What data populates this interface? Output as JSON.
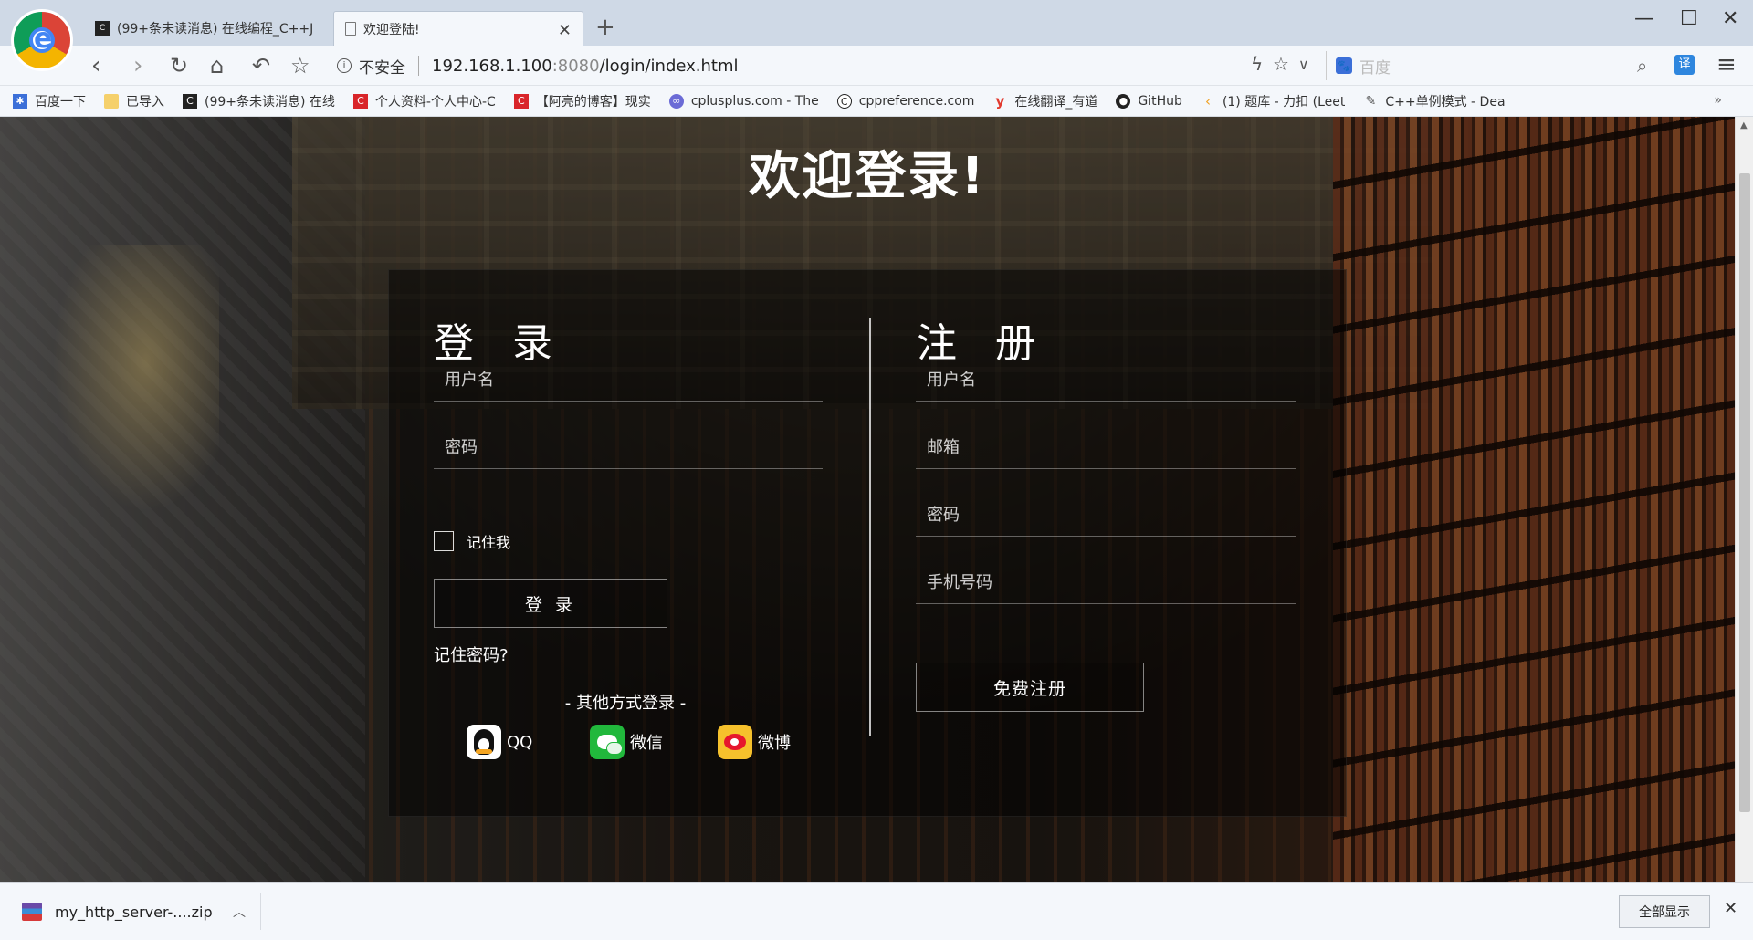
{
  "browser": {
    "tabs": [
      {
        "label": "(99+条未读消息) 在线编程_C++J",
        "active": false
      },
      {
        "label": "欢迎登陆!",
        "active": true
      }
    ],
    "address": {
      "security_label": "不安全",
      "url_host": "192.168.1.100",
      "url_port": ":8080",
      "url_path": "/login/index.html"
    },
    "search": {
      "placeholder": "百度"
    },
    "translate_label": "译"
  },
  "bookmarks": [
    {
      "label": "百度一下",
      "icon": "baidu-icon",
      "color": "#3b6fd8"
    },
    {
      "label": "已导入",
      "icon": "folder-icon",
      "color": "#f5d06b"
    },
    {
      "label": "(99+条未读消息) 在线",
      "icon": "csdn-icon",
      "color": "#222222"
    },
    {
      "label": "个人资料-个人中心-C",
      "icon": "csdn-c-icon",
      "color": "#d9252a"
    },
    {
      "label": "【阿亮的博客】现实",
      "icon": "csdn-c-icon",
      "color": "#d9252a"
    },
    {
      "label": "cplusplus.com - The",
      "icon": "cplusplus-icon",
      "color": "#6b6bd6"
    },
    {
      "label": "cppreference.com",
      "icon": "cppreference-icon",
      "color": "#222222"
    },
    {
      "label": "在线翻译_有道",
      "icon": "youdao-icon",
      "color": "#e23a2e"
    },
    {
      "label": "GitHub",
      "icon": "github-icon",
      "color": "#222222"
    },
    {
      "label": "(1) 题库 - 力扣 (Leet",
      "icon": "leetcode-icon",
      "color": "#f0a020"
    },
    {
      "label": "C++单例模式 - Dea",
      "icon": "bookmark-generic-icon",
      "color": "#555555"
    }
  ],
  "page": {
    "title": "欢迎登录!",
    "login": {
      "heading": "登 录",
      "username_placeholder": "用户名",
      "password_placeholder": "密码",
      "remember_label": "记住我",
      "submit_label": "登 录",
      "forgot_label": "记住密码?",
      "other_label": "- 其他方式登录 -",
      "social": [
        {
          "label": "QQ",
          "icon": "qq-icon"
        },
        {
          "label": "微信",
          "icon": "wechat-icon"
        },
        {
          "label": "微博",
          "icon": "weibo-icon"
        }
      ]
    },
    "register": {
      "heading": "注 册",
      "username_placeholder": "用户名",
      "email_placeholder": "邮箱",
      "password_placeholder": "密码",
      "phone_placeholder": "手机号码",
      "submit_label": "免费注册"
    }
  },
  "downloads": {
    "file_name": "my_http_server-....zip",
    "show_all_label": "全部显示"
  }
}
